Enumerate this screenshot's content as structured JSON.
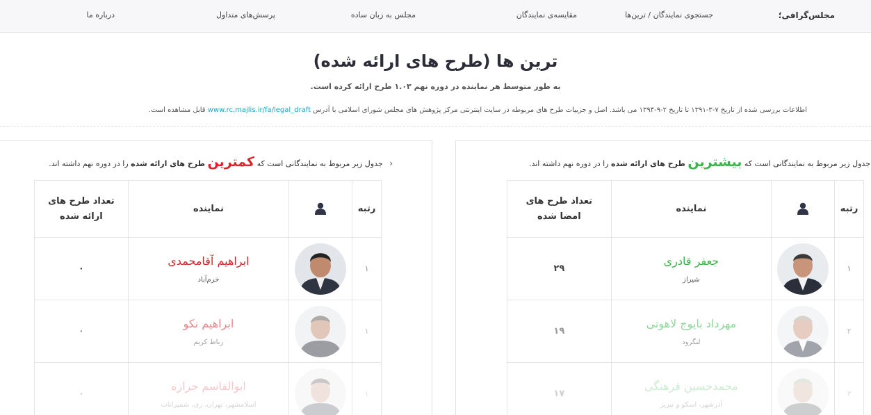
{
  "nav": {
    "brand": "مجلس‌گرافی؛",
    "items": [
      "جستجوی نمایندگان / ترین‌ها",
      "مقایسه‌ی نمایندگان",
      "مجلس به زبان ساده",
      "پرسش‌های متداول",
      "درباره ما"
    ]
  },
  "header": {
    "title": "ترین ها (طرح های ارائه شده)",
    "subtitle": "به طور متوسط هر نماینده در دوره نهم ۱.۰۳ طرح ارائه کرده است.",
    "info_text": "اطلاعات بررسی شده از تاریخ ۷-۳-۱۳۹۱ تا تاریخ ۲-۹-۱۳۹۴ می باشد. اصل و جزییات طرح های مربوطه در سایت اینترنتی مرکز پژوهش های مجلس شورای اسلامی با آدرس",
    "info_link": "www.rc.majlis.ir/fa/legal_draft",
    "info_tail": "قابل مشاهده است."
  },
  "most": {
    "desc_pre": "جدول زیر مربوط به نمایندگانی است که",
    "desc_hl": "بیشترین",
    "desc_bold": "طرح های ارائه شده",
    "desc_post": "را در دوره نهم داشته اند.",
    "col_rank": "رتبه",
    "col_rep": "نماینده",
    "col_count": "تعداد طرح های امضا شده",
    "rows": [
      {
        "rank": "۱",
        "name": "جعفر قادری",
        "city": "شیراز",
        "count": "۲۹"
      },
      {
        "rank": "۲",
        "name": "مهرداد بایوج لاهوتی",
        "city": "لنگرود",
        "count": "۱۹"
      },
      {
        "rank": "۳",
        "name": "محمدحسین فرهنگی",
        "city": "آذرشهر، اسکو و تبریز",
        "count": "۱۷"
      }
    ]
  },
  "least": {
    "desc_pre": "جدول زیر مربوط به نمایندگانی است که",
    "desc_hl": "کمترین",
    "desc_bold": "طرح های ارائه شده",
    "desc_post": "را در دوره نهم داشته اند.",
    "col_rank": "رتبه",
    "col_rep": "نماینده",
    "col_count": "تعداد طرح های ارائه شده",
    "rows": [
      {
        "rank": "۱",
        "name": "ابراهیم آقامحمدی",
        "city": "خرم‌آباد",
        "count": "۰"
      },
      {
        "rank": "۱",
        "name": "ابراهیم نکو",
        "city": "رباط کریم",
        "count": "۰"
      },
      {
        "rank": "۱",
        "name": "ابوالقاسم جراره",
        "city": "اسلامشهر، تهران، ری، شمیرانات",
        "count": "۰"
      }
    ]
  },
  "colors": {
    "green": "#3ab54a",
    "red": "#d9252a",
    "link": "#1aa3c4"
  }
}
